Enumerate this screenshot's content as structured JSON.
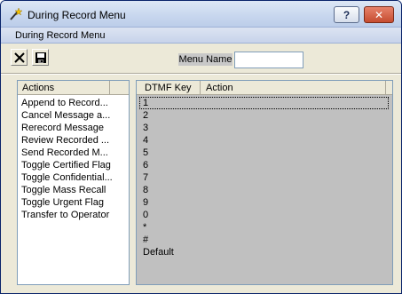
{
  "window": {
    "title": "During Record Menu",
    "help_label": "?",
    "close_label": "✕"
  },
  "menubar": {
    "label": "During Record Menu"
  },
  "toolbar": {
    "delete_icon": "x-icon",
    "save_icon": "floppy-disk-icon",
    "menu_name_label": "Menu Name",
    "menu_name_value": ""
  },
  "actions_list": {
    "header": "Actions",
    "items": [
      "Append to Record...",
      "Cancel Message a...",
      "Rerecord Message",
      "Review Recorded ...",
      "Send Recorded M...",
      "Toggle Certified Flag",
      "Toggle Confidential...",
      "Toggle Mass Recall",
      "Toggle Urgent Flag",
      "Transfer to Operator"
    ]
  },
  "dtmf_table": {
    "col_key": "DTMF Key",
    "col_action": "Action",
    "rows": [
      "1",
      "2",
      "3",
      "4",
      "5",
      "6",
      "7",
      "8",
      "9",
      "0",
      "*",
      "#",
      "Default"
    ],
    "selected_row": "1"
  }
}
